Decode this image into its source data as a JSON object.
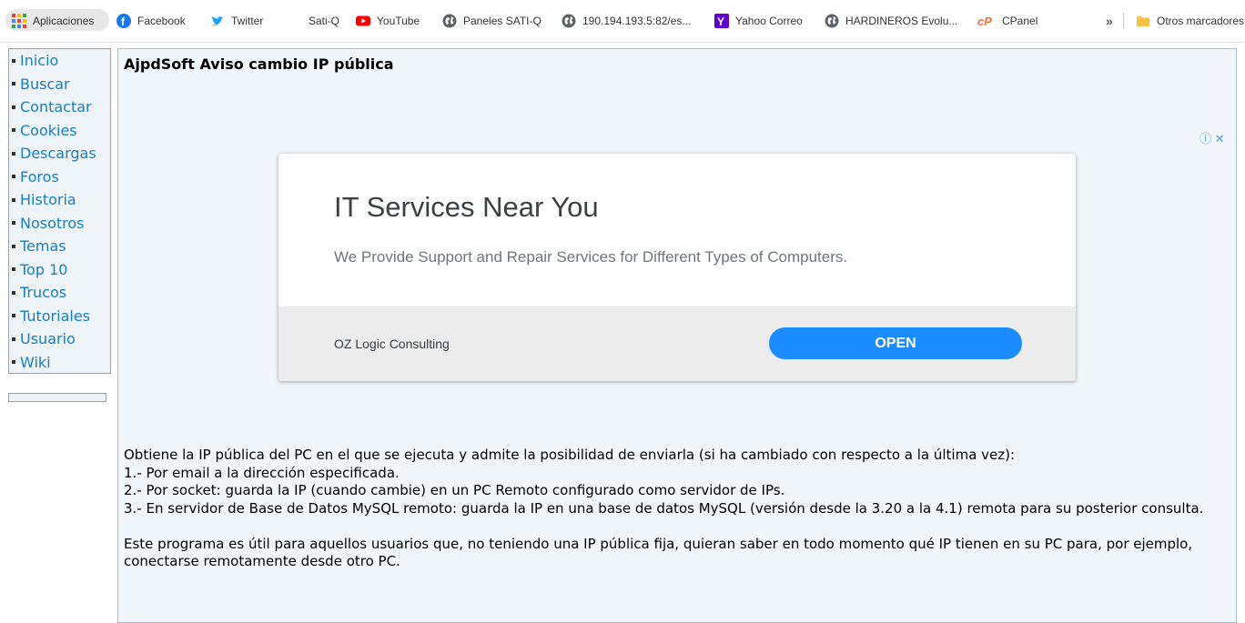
{
  "bookmarks": [
    {
      "label": "Aplicaciones",
      "icon": "apps-grid-icon"
    },
    {
      "label": "Facebook",
      "icon": "facebook-icon"
    },
    {
      "label": "Twitter",
      "icon": "twitter-icon"
    },
    {
      "label": "Sati-Q",
      "icon": ""
    },
    {
      "label": "YouTube",
      "icon": "youtube-icon"
    },
    {
      "label": "Paneles SATI-Q",
      "icon": "globe-icon"
    },
    {
      "label": "190.194.193.5:82/es...",
      "icon": "globe-icon"
    },
    {
      "label": "Yahoo Correo",
      "icon": "yahoo-icon"
    },
    {
      "label": "HARDINEROS Evolu...",
      "icon": "globe-icon"
    },
    {
      "label": "CPanel",
      "icon": "cpanel-icon"
    }
  ],
  "bookmarks_overflow": "»",
  "other_bookmarks": "Otros marcadores",
  "colors": {
    "link": "#1a7dbf",
    "ad_button": "#1a8cff",
    "facebook": "#1877f2",
    "twitter": "#1da1f2",
    "youtube": "#ff0000",
    "yahoo": "#5f01d1",
    "cpanel": "#ff6c2c"
  },
  "nav": {
    "items": [
      "Inicio",
      "Buscar",
      "Contactar",
      "Cookies",
      "Descargas",
      "Foros",
      "Historia",
      "Nosotros",
      "Temas",
      "Top 10",
      "Trucos",
      "Tutoriales",
      "Usuario",
      "Wiki"
    ]
  },
  "article": {
    "title": "AjpdSoft Aviso cambio IP pública",
    "adchoices": "ⓘ ✕",
    "ad": {
      "title": "IT Services Near You",
      "subtitle": "We Provide Support and Repair Services for Different Types of Computers.",
      "advertiser": "OZ Logic Consulting",
      "button": "OPEN"
    },
    "paragraphs": [
      "Obtiene la IP pública del PC en el que se ejecuta y admite la posibilidad de enviarla (si ha cambiado con respecto a la última vez):",
      "1.- Por email a la dirección especificada.",
      "2.- Por socket: guarda la IP (cuando cambie) en un PC Remoto configurado como servidor de IPs.",
      "3.- En servidor de Base de Datos MySQL remoto: guarda la IP en una base de datos MySQL (versión desde la 3.20 a la 4.1) remota para su posterior consulta.",
      "",
      "Este programa es útil para aquellos usuarios que, no teniendo una IP pública fija, quieran saber en todo momento qué IP tienen en su PC para, por ejemplo, conectarse remotamente desde otro PC."
    ]
  }
}
